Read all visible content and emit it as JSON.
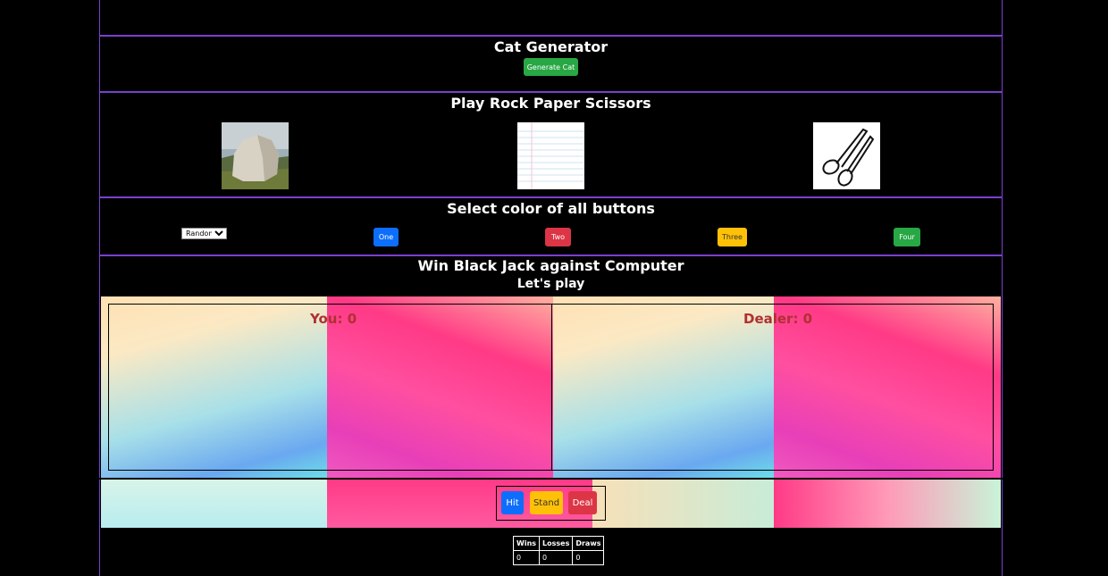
{
  "cat": {
    "title": "Cat Generator",
    "button": "Generate Cat"
  },
  "rps": {
    "title": "Play Rock Paper Scissors",
    "choices": [
      "rock",
      "paper",
      "scissors"
    ]
  },
  "colors": {
    "title": "Select color of all buttons",
    "select_value": "Random",
    "buttons": [
      "One",
      "Two",
      "Three",
      "Four"
    ],
    "button_colors": [
      "#0d6efd",
      "#dc3545",
      "#ffc107",
      "#28a745"
    ]
  },
  "blackjack": {
    "title": "Win Black Jack against Computer",
    "subtitle": "Let's play",
    "you": "You: 0",
    "dealer": "Dealer: 0",
    "hit": "Hit",
    "stand": "Stand",
    "deal": "Deal"
  },
  "stats": {
    "headers": [
      "Wins",
      "Losses",
      "Draws"
    ],
    "values": [
      "0",
      "0",
      "0"
    ]
  }
}
